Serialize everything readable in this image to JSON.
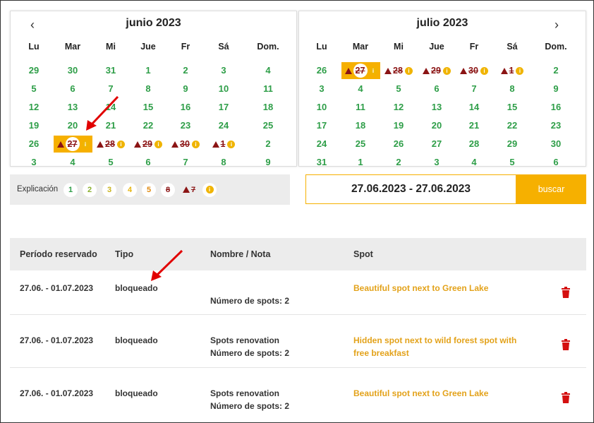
{
  "calendar_left": {
    "title": "junio 2023",
    "prev_icon": "chevron-left-icon",
    "weekdays": [
      "Lu",
      "Mar",
      "Mi",
      "Jue",
      "Fr",
      "Sá",
      "Dom."
    ],
    "rows": [
      [
        "29",
        "30",
        "31",
        "1",
        "2",
        "3",
        "4"
      ],
      [
        "5",
        "6",
        "7",
        "8",
        "9",
        "10",
        "11"
      ],
      [
        "12",
        "13",
        "14",
        "15",
        "16",
        "17",
        "18"
      ],
      [
        "19",
        "20",
        "21",
        "22",
        "23",
        "24",
        "25"
      ],
      [
        "26",
        "27",
        "28",
        "29",
        "30",
        "1",
        "2"
      ],
      [
        "3",
        "4",
        "5",
        "6",
        "7",
        "8",
        "9"
      ]
    ]
  },
  "calendar_right": {
    "title": "julio 2023",
    "next_icon": "chevron-right-icon",
    "weekdays": [
      "Lu",
      "Mar",
      "Mi",
      "Jue",
      "Fr",
      "Sá",
      "Dom."
    ],
    "rows": [
      [
        "26",
        "27",
        "28",
        "29",
        "30",
        "1",
        "2"
      ],
      [
        "3",
        "4",
        "5",
        "6",
        "7",
        "8",
        "9"
      ],
      [
        "10",
        "11",
        "12",
        "13",
        "14",
        "15",
        "16"
      ],
      [
        "17",
        "18",
        "19",
        "20",
        "21",
        "22",
        "23"
      ],
      [
        "24",
        "25",
        "26",
        "27",
        "28",
        "29",
        "30"
      ],
      [
        "31",
        "1",
        "2",
        "3",
        "4",
        "5",
        "6"
      ]
    ]
  },
  "legend": {
    "label": "Explicación",
    "items": [
      "1",
      "2",
      "3",
      "4",
      "5",
      "8",
      "7"
    ]
  },
  "search": {
    "date_range": "27.06.2023 - 27.06.2023",
    "button_label": "buscar"
  },
  "table": {
    "headers": [
      "Período reservado",
      "Tipo",
      "Nombre / Nota",
      "Spot"
    ],
    "rows": [
      {
        "period": "27.06. - 01.07.2023",
        "type": "bloqueado",
        "name": "",
        "spots": "Número de spots: 2",
        "spot": "Beautiful spot next to Green Lake",
        "spot_line2": ""
      },
      {
        "period": "27.06. - 01.07.2023",
        "type": "bloqueado",
        "name": "Spots renovation",
        "spots": "Número de spots: 2",
        "spot": "Hidden spot next to wild forest spot with",
        "spot_line2": "free breakfast"
      },
      {
        "period": "27.06. - 01.07.2023",
        "type": "bloqueado",
        "name": "Spots renovation",
        "spots": "Número de spots: 2",
        "spot": "Beautiful spot next to Green Lake",
        "spot_line2": ""
      }
    ]
  },
  "colors": {
    "available": "#2e9e48",
    "blocked": "#8b1414",
    "accent": "#f6b000",
    "spot_link": "#e3a21a",
    "delete": "#d40f0f"
  }
}
